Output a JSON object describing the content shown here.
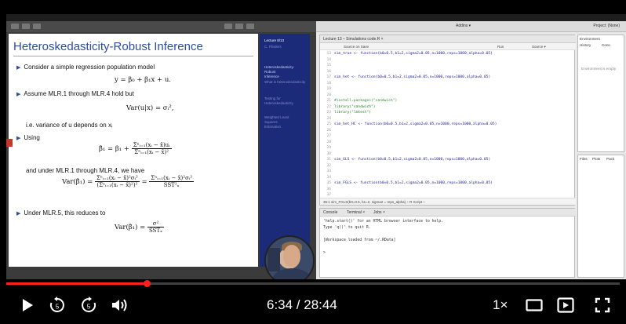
{
  "slide": {
    "title": "Heteroskedasticity-Robust Inference",
    "bullet1": "Consider a simple regression population model",
    "eq1": "y = β₀ + β₁x + u.",
    "bullet2": "Assume MLR.1 through MLR.4 hold but",
    "eq2": "Var(u|x) = σᵢ²,",
    "note": "i.e. variance of u depends on xᵢ",
    "bullet3": "Using",
    "eq3_lhs": "β̂₁ = β₁ +",
    "eq3_num": "Σⁿᵢ₌₁(xᵢ − x̄)uᵢ",
    "eq3_den": "Σⁿᵢ₌₁(xᵢ − x̄)²",
    "under_text": "and under MLR.1 through MLR.4, we have",
    "eq4_lhs": "Var(β̂₁) =",
    "eq4_num1": "Σⁿᵢ₌₁(xᵢ − x̄)²σᵢ²",
    "eq4_den1": "(Σⁿᵢ₌₁(xᵢ − x̄)²)²",
    "eq4_mid": "=",
    "eq4_num2": "Σⁿᵢ₌₁(xᵢ − x̄)²σᵢ²",
    "eq4_den2": "SST²ₓ",
    "bullet4": "Under MLR.5, this reduces to",
    "eq5_lhs": "Var(β̂₁) =",
    "eq5_num": "σ²",
    "eq5_den": "SSTₓ"
  },
  "sidebar": {
    "lecture": "Lecture 8/13",
    "author": "C. Flinders",
    "items": [
      "Heteroskedasticity-",
      "Robust",
      "Inference",
      "What is heteroskedasticity",
      "Testing for",
      "Heteroskedasticity",
      "Weighted Least",
      "Squares",
      "Estimation"
    ]
  },
  "rstudio": {
    "addins": "Addins ▾",
    "project": "Project: (None)",
    "editor_tab": "Lecture 13 – Simulations code.R ×",
    "tools": [
      "Source on Save",
      "Run",
      "Source ▾"
    ],
    "code_lines": [
      {
        "n": "13",
        "t": "sim_true <- function(b0=0.5,b1=2,sigma2=0.05,n=1000,reps=1000,alpha=0.05)",
        "k": "fn"
      },
      {
        "n": "14",
        "t": "",
        "k": ""
      },
      {
        "n": "15",
        "t": "sim_true()",
        "k": ""
      },
      {
        "n": "16",
        "t": "",
        "k": ""
      },
      {
        "n": "17",
        "t": "sim_het <- function(b0=0.5,b1=2,sigma2=0.05,n=1000,reps=1000,alpha=0.05)",
        "k": "fn"
      },
      {
        "n": "18",
        "t": "",
        "k": ""
      },
      {
        "n": "19",
        "t": "sim_het()",
        "k": ""
      },
      {
        "n": "20",
        "t": "",
        "k": ""
      },
      {
        "n": "21",
        "t": "#install.packages(\"sandwich\")",
        "k": "cm"
      },
      {
        "n": "22",
        "t": "library(\"sandwich\")",
        "k": "st"
      },
      {
        "n": "23",
        "t": "library(\"lmtest\")",
        "k": "st"
      },
      {
        "n": "24",
        "t": "",
        "k": ""
      },
      {
        "n": "25",
        "t": "sim_het_HC <- function(b0=0.5,b1=2,sigma2=0.05,n=1000,reps=1000,alpha=0.05)",
        "k": "fn"
      },
      {
        "n": "26",
        "t": "",
        "k": ""
      },
      {
        "n": "27",
        "t": "sim_het_HC()",
        "k": ""
      },
      {
        "n": "28",
        "t": "sim_het_HC(n=100)",
        "k": ""
      },
      {
        "n": "29",
        "t": "sim_het_HC(n=10)",
        "k": ""
      },
      {
        "n": "30",
        "t": "",
        "k": ""
      },
      {
        "n": "31",
        "t": "sim_GLS <- function(b0=0.5,b1=2,sigma2=0.05,n=1000,reps=1000,alpha=0.05)",
        "k": "fn"
      },
      {
        "n": "32",
        "t": "",
        "k": ""
      },
      {
        "n": "33",
        "t": "sim_GLS()",
        "k": ""
      },
      {
        "n": "34",
        "t": "",
        "k": ""
      },
      {
        "n": "35",
        "t": "sim_FGLS <- function(b0=0.5,b1=2,sigma2=0.05,n=1000,reps=1000,alpha=0.05)",
        "k": "fn"
      },
      {
        "n": "36",
        "t": "",
        "k": ""
      },
      {
        "n": "37",
        "t": "sim_FGLS()",
        "k": ""
      }
    ],
    "editor_status": "35:1   sim_FGLS(b0=0.5, b1=2, sigma2 = reps_alpha) ÷      R Script ÷",
    "console_tabs": [
      "Console",
      "Terminal ×",
      "Jobs ×"
    ],
    "console_lines": [
      "'help.start()' for an HTML browser interface to help.",
      "Type 'q()' to quit R.",
      "",
      "[Workspace loaded from ~/.RData]",
      "",
      ">"
    ],
    "env_tabs": [
      "Environment",
      "History",
      "Conn"
    ],
    "env_empty": "Environment is empty",
    "files_tabs": [
      "Files",
      "Plots",
      "Pack"
    ]
  },
  "player": {
    "time": "6:34 / 28:44",
    "progress_fraction": 0.2285,
    "speed": "1×"
  }
}
